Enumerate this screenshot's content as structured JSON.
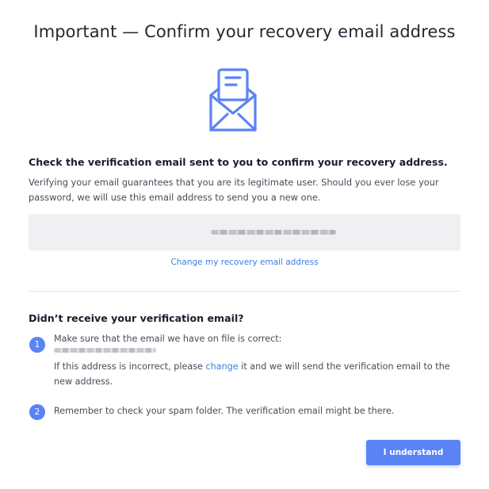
{
  "dialog": {
    "title": "Important — Confirm your recovery email address"
  },
  "icons": {
    "envelope": "envelope-open-letter-icon"
  },
  "verify": {
    "heading": "Check the verification email sent to you to confirm your recovery address.",
    "description": "Verifying your email guarantees that you are its legitimate user. Should you ever lose your password, we will use this email address to send you a new one.",
    "change_link": "Change my recovery email address"
  },
  "not_received": {
    "heading": "Didn’t receive your verification email?",
    "steps": [
      {
        "number": "1",
        "line1": "Make sure that the email we have on file is correct:",
        "line2_before": "If this address is incorrect, please ",
        "line2_link": "change",
        "line2_after": " it and we will send the verification email to the",
        "line3": "new address."
      },
      {
        "number": "2",
        "text": "Remember to check your spam folder. The verification email might be there."
      }
    ]
  },
  "actions": {
    "understand_label": "I understand"
  },
  "colors": {
    "accent": "#5a84f5",
    "link": "#3f7fd9",
    "field_bg": "#f0f0f2"
  }
}
